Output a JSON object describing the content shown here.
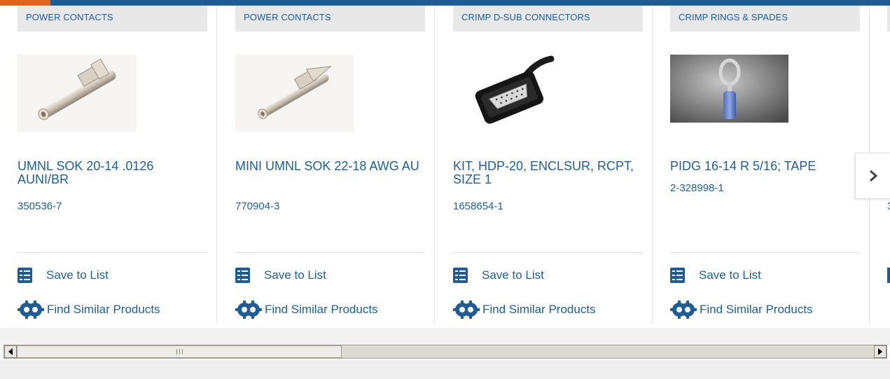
{
  "colors": {
    "brand_blue": "#1d5c95",
    "link_blue": "#1a5fa3",
    "accent_orange": "#e0621c",
    "tag_bg": "#e8e8e8"
  },
  "products": [
    {
      "category": "POWER CONTACTS",
      "title": "UMNL SOK 20-14 .0126 AUNI/BR",
      "part_number": "350536-7",
      "save_label": "Save to List",
      "similar_label": "Find Similar Products",
      "image": "pin-contact-image"
    },
    {
      "category": "POWER CONTACTS",
      "title": "MINI UMNL SOK 22-18 AWG AU",
      "part_number": "770904-3",
      "save_label": "Save to List",
      "similar_label": "Find Similar Products",
      "image": "pin-contact-image"
    },
    {
      "category": "CRIMP D-SUB CONNECTORS",
      "title": "KIT, HDP-20, ENCLSUR, RCPT, SIZE 1",
      "part_number": "1658654-1",
      "save_label": "Save to List",
      "similar_label": "Find Similar Products",
      "image": "dsub-connector-image"
    },
    {
      "category": "CRIMP RINGS & SPADES",
      "title": "PIDG 16-14 R 5/16; TAPE",
      "part_number": "2-328998-1",
      "save_label": "Save to List",
      "similar_label": "Find Similar Products",
      "image": "ring-terminal-image"
    }
  ],
  "partial_card": {
    "part_number_fragment": "3"
  },
  "carousel": {
    "next_icon": "chevron-right-icon"
  },
  "scrollbar": {
    "left_icon": "arrow-left-icon",
    "right_icon": "arrow-right-icon",
    "position_fraction": 0.0,
    "visible_fraction": 0.37
  }
}
